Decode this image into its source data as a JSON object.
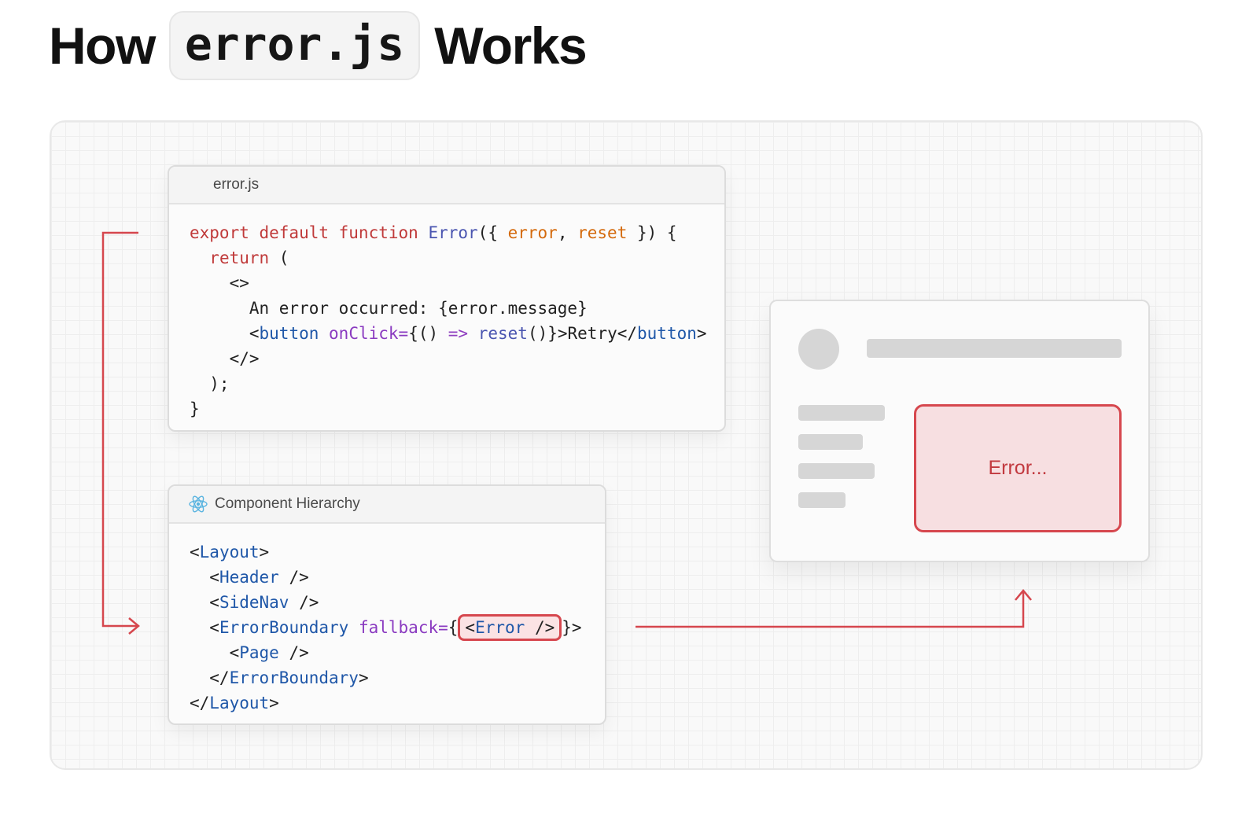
{
  "heading": {
    "before": "How",
    "code": "error.js",
    "after": "Works"
  },
  "error_file": {
    "filename": "error.js",
    "lines": [
      "export default function Error({ error, reset }) {",
      "  return (",
      "    <>",
      "      An error occurred: {error.message}",
      "      <button onClick={() => reset()}>Retry</button>",
      "    </>",
      "  );",
      "}"
    ]
  },
  "hierarchy": {
    "title": "Component Hierarchy",
    "lines": [
      "<Layout>",
      "  <Header />",
      "  <SideNav />",
      "  <ErrorBoundary fallback={<Error />}>",
      "    <Page />",
      "  </ErrorBoundary>",
      "</Layout>"
    ]
  },
  "preview": {
    "error_text": "Error..."
  },
  "colors": {
    "accent_red": "#d6474e",
    "error_fill": "#f7dfe1",
    "skeleton": "#d6d6d6"
  },
  "icons": [
    "react-icon"
  ]
}
